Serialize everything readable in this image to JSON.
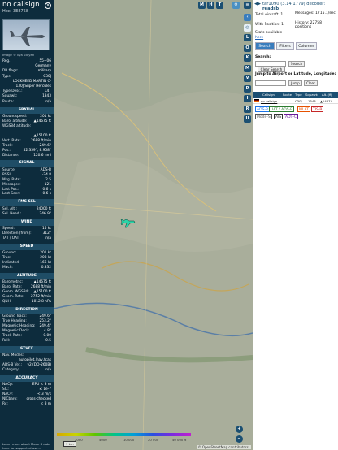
{
  "aircraft": {
    "callsign": "no callsign",
    "hex_label": "Hex:",
    "hex": "3E8758",
    "photo_credit": "Image © Ilya Stoyan"
  },
  "details": [
    {
      "k": "Reg.:",
      "v": "55+06"
    },
    {
      "k": "",
      "v": "Germany"
    },
    {
      "k": "DB flags:",
      "v": "military"
    },
    {
      "k": "Type:",
      "v": "C30J"
    },
    {
      "k": "",
      "v": "LOCKHEED MARTIN C-"
    },
    {
      "k": "",
      "v": "130J Super Hercules"
    },
    {
      "k": "Type Desc.:",
      "v": "L4T"
    },
    {
      "k": "Squawk:",
      "v": "1343"
    },
    {
      "k": "Route:",
      "v": "n/a"
    }
  ],
  "sections": [
    {
      "title": "SPATIAL",
      "rows": [
        {
          "k": "Groundspeed:",
          "v": "201 kt"
        },
        {
          "k": "Baro. altitude:",
          "v": "▲14675 ft"
        },
        {
          "k": "WGS84 altitude:",
          "v": ""
        },
        {
          "k": "",
          "v": ""
        },
        {
          "k": "",
          "v": "▲15100 ft"
        },
        {
          "k": "Vert. Rate:",
          "v": "2688 ft/min"
        },
        {
          "k": "Track:",
          "v": "249.6°"
        },
        {
          "k": "Pos.:",
          "v": "52.359°, 8.958°"
        },
        {
          "k": "Distance:",
          "v": "120.6 nmi"
        }
      ]
    },
    {
      "title": "SIGNAL",
      "rows": [
        {
          "k": "Source:",
          "v": "ADS-B"
        },
        {
          "k": "RSSI:",
          "v": "-24.8"
        },
        {
          "k": "Msg. Rate:",
          "v": "2.5"
        },
        {
          "k": "Messages:",
          "v": "121"
        },
        {
          "k": "Last Pos.:",
          "v": "0.6 s"
        },
        {
          "k": "Last Seen:",
          "v": "0.6 s"
        }
      ]
    },
    {
      "title": "FMS SEL",
      "rows": [
        {
          "k": "Sel. Alt.:",
          "v": "24000 ft"
        },
        {
          "k": "Sel. Head.:",
          "v": "246.9°"
        }
      ]
    },
    {
      "title": "WIND",
      "rows": [
        {
          "k": "Speed:",
          "v": "15 kt"
        },
        {
          "k": "Direction (from):",
          "v": "312°"
        },
        {
          "k": "TAT / OAT:",
          "v": "n/a"
        }
      ]
    },
    {
      "title": "SPEED",
      "rows": [
        {
          "k": "Ground:",
          "v": "201 kt"
        },
        {
          "k": "True:",
          "v": "208 kt"
        },
        {
          "k": "Indicated:",
          "v": "166 kt"
        },
        {
          "k": "Mach:",
          "v": "0.332"
        }
      ]
    },
    {
      "title": "ALTITUDE",
      "rows": [
        {
          "k": "Barometric:",
          "v": "▲14675 ft"
        },
        {
          "k": "Baro. Rate:",
          "v": "2688 ft/min"
        },
        {
          "k": "Geom. WGS84:",
          "v": "▲15100 ft"
        },
        {
          "k": "Geom. Rate:",
          "v": "2752 ft/min"
        },
        {
          "k": "QNH:",
          "v": "1012.8 hPa"
        }
      ]
    },
    {
      "title": "DIRECTION",
      "rows": [
        {
          "k": "Ground Track:",
          "v": "249.6°"
        },
        {
          "k": "True Heading:",
          "v": "253.2°"
        },
        {
          "k": "Magnetic Heading:",
          "v": "249.4°"
        },
        {
          "k": "Magnetic Decl.:",
          "v": "4.8°"
        },
        {
          "k": "Track Rate:",
          "v": "0.00"
        },
        {
          "k": "Roll:",
          "v": "0.5"
        }
      ]
    },
    {
      "title": "STUFF",
      "rows": [
        {
          "k": "Nav. Modes:",
          "v": ""
        },
        {
          "k": "",
          "v": "autopilot,lnav,tcas"
        },
        {
          "k": "ADS-B Ver.:",
          "v": "v2 (DO-260B)"
        },
        {
          "k": "Category:",
          "v": "n/a"
        }
      ]
    },
    {
      "title": "ACCURACY",
      "rows": [
        {
          "k": "NACp:",
          "v": "EPU < 3 m"
        },
        {
          "k": "SIL:",
          "v": "≤ 1e-7"
        },
        {
          "k": "NACv:",
          "v": "< 3 m/s"
        },
        {
          "k": "NICbaro:",
          "v": "cross-checked"
        },
        {
          "k": "Rc:",
          "v": "< 8 m"
        }
      ]
    }
  ],
  "footer": "Learn more about Mode S data here for supported use...",
  "map": {
    "buttons_top": [
      "M",
      "H",
      "T"
    ],
    "side_buttons": [
      "L",
      "O",
      "K",
      "M",
      "V",
      "P",
      "I",
      "R",
      "U"
    ],
    "scale_labels": [
      "1 km",
      "2000",
      "4000",
      "10 000",
      "20 000",
      "40 000 ft"
    ],
    "osm": "© OpenStreetMap contributors."
  },
  "right": {
    "title": "tar1090 (3.14.1779) decoder:",
    "readsb": "readsb",
    "total_aircraft": "Total Aircraft: 1",
    "messages": "Messages: 1715.1/sec",
    "with_position": "With Position: 1",
    "history": "History: 22758 positions",
    "stats": "Stats available",
    "here": "here",
    "tabs": [
      "Search",
      "Filters",
      "Columns"
    ],
    "search_label": "Search:",
    "search_btn": "Search",
    "clear_search": "Clear Search",
    "jump_label": "Jump to Airport or Latitude, Longitude:",
    "jump_btn": "Jump",
    "clear_btn": "Clear",
    "table_headers": [
      "Callsign",
      "Route",
      "Type",
      "Squawk",
      "Alt. (ft)"
    ],
    "row": {
      "callsign": "no callsign",
      "type": "C30J",
      "squawk": "1343",
      "alt": "▲14675"
    },
    "legend": [
      "ADS-B",
      "UAT / ADS-R",
      "MLAT",
      "TIS-B",
      "Mode-S",
      "AIS",
      "ADS-C"
    ],
    "colors": {
      "adsb": "#1a73e8",
      "uat": "#2e7d32",
      "mlat": "#e65100",
      "tisb": "#c62828",
      "modes": "#555555",
      "ais": "#333333",
      "adsc": "#6a1b9a"
    }
  }
}
